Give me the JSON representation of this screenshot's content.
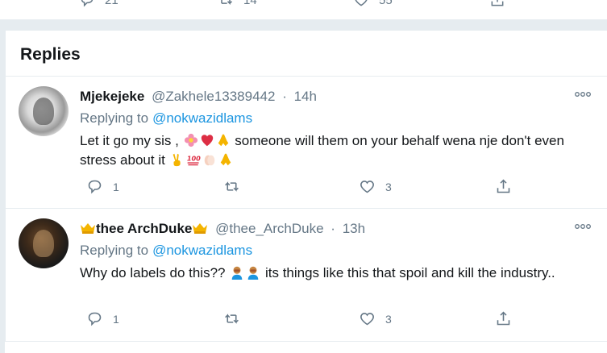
{
  "top_actions": {
    "reply_count": "21",
    "retweet_count": "14",
    "like_count": "55"
  },
  "section_title": "Replies",
  "tweets": [
    {
      "name": "Mjekejeke",
      "handle": "@Zakhele13389442",
      "sep": "·",
      "time": "14h",
      "replying_label": "Replying to",
      "replying_handle": "@nokwazidlams",
      "text_a": "Let it go my sis ,",
      "text_b": "someone will them on your behalf wena nje don't even stress about it",
      "reply_count": "1",
      "retweet_count": "",
      "like_count": "3"
    },
    {
      "name": "thee ArchDuke",
      "handle": "@thee_ArchDuke",
      "sep": "·",
      "time": "13h",
      "replying_label": "Replying to",
      "replying_handle": "@nokwazidlams",
      "text_a": "Why do labels do this??",
      "text_b": "its things like this that spoil and kill the industry..",
      "reply_count": "1",
      "retweet_count": "",
      "like_count": "3"
    }
  ],
  "colors": {
    "accent": "#1b95e0",
    "muted": "#657786",
    "text": "#14171a",
    "divider": "#e6ecf0"
  }
}
